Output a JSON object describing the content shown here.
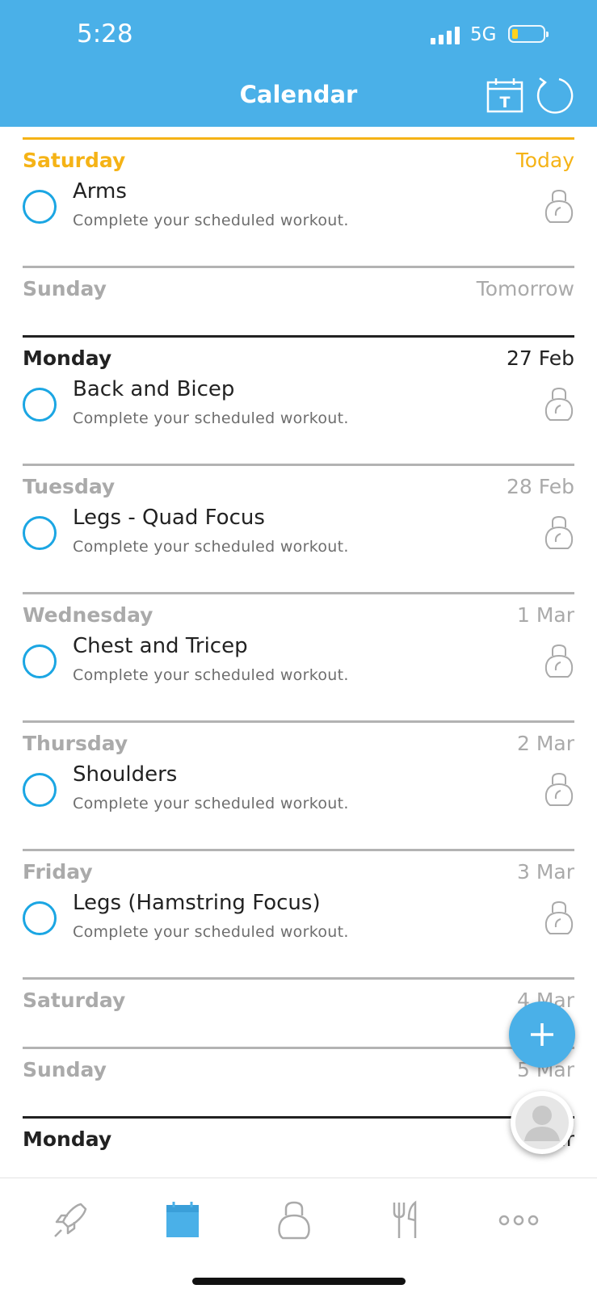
{
  "status": {
    "time": "5:28",
    "network": "5G"
  },
  "header": {
    "title": "Calendar",
    "today_icon_letter": "T"
  },
  "days": [
    {
      "name": "Saturday",
      "date": "Today",
      "state": "today",
      "workouts": [
        {
          "name": "Arms",
          "subtitle": "Complete your scheduled workout."
        }
      ]
    },
    {
      "name": "Sunday",
      "date": "Tomorrow",
      "state": "past",
      "workouts": []
    },
    {
      "name": "Monday",
      "date": "27 Feb",
      "state": "upcoming",
      "workouts": [
        {
          "name": "Back and Bicep",
          "subtitle": "Complete your scheduled workout."
        }
      ]
    },
    {
      "name": "Tuesday",
      "date": "28 Feb",
      "state": "past",
      "workouts": [
        {
          "name": "Legs - Quad Focus",
          "subtitle": "Complete your scheduled workout."
        }
      ]
    },
    {
      "name": "Wednesday",
      "date": "1 Mar",
      "state": "past",
      "workouts": [
        {
          "name": "Chest and Tricep",
          "subtitle": "Complete your scheduled workout."
        }
      ]
    },
    {
      "name": "Thursday",
      "date": "2 Mar",
      "state": "past",
      "workouts": [
        {
          "name": "Shoulders",
          "subtitle": "Complete your scheduled workout."
        }
      ]
    },
    {
      "name": "Friday",
      "date": "3 Mar",
      "state": "past",
      "workouts": [
        {
          "name": "Legs (Hamstring Focus)",
          "subtitle": "Complete your scheduled workout."
        }
      ]
    },
    {
      "name": "Saturday",
      "date": "4 Mar",
      "state": "past",
      "workouts": []
    },
    {
      "name": "Sunday",
      "date": "5 Mar",
      "state": "past",
      "workouts": []
    },
    {
      "name": "Monday",
      "date": "6 Mar",
      "state": "upcoming",
      "workouts": []
    }
  ],
  "tabs": [
    {
      "icon": "rocket-icon",
      "active": false
    },
    {
      "icon": "calendar-icon",
      "active": true
    },
    {
      "icon": "kettlebell-icon",
      "active": false
    },
    {
      "icon": "fork-knife-icon",
      "active": false
    },
    {
      "icon": "more-icon",
      "active": false
    }
  ],
  "colors": {
    "brand": "#4ab0e8",
    "today": "#f5b316",
    "check": "#1ba6e3",
    "muted": "#aaaaaa",
    "dark": "#222222"
  }
}
